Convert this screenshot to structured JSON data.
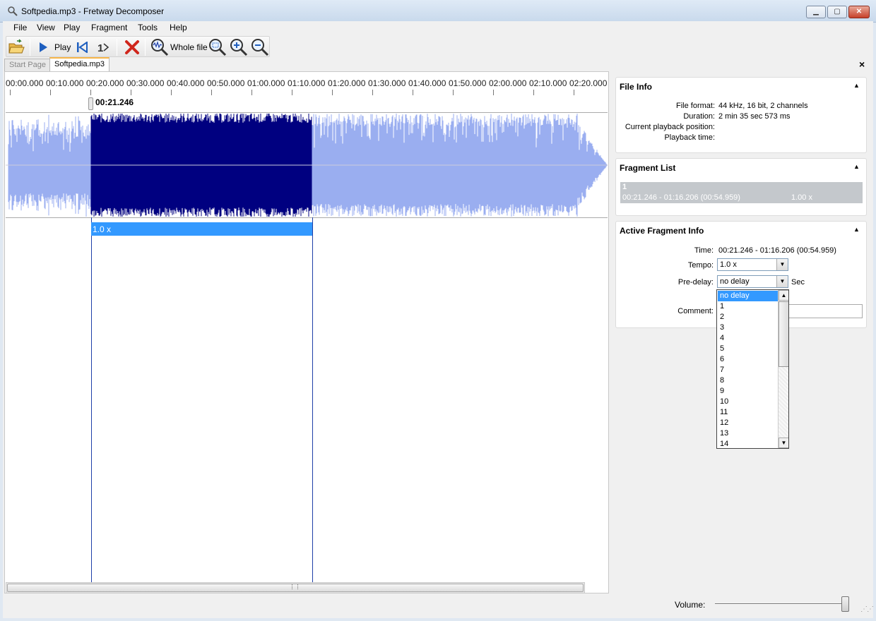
{
  "window": {
    "title": "Softpedia.mp3 - Fretway Decomposer",
    "buttons": {
      "minimize": "▁",
      "maximize": "▢",
      "close": "✕"
    }
  },
  "menu": [
    "File",
    "View",
    "Play",
    "Fragment",
    "Tools",
    "Help"
  ],
  "toolbar": {
    "play_label": "Play",
    "whole_file_label": "Whole file",
    "icons": [
      "open-folder-icon",
      "play-icon",
      "skip-to-start-icon",
      "repeat-one-icon",
      "delete-icon",
      "whole-file-zoom-icon",
      "zoom-fit-icon",
      "zoom-in-icon",
      "zoom-out-icon"
    ]
  },
  "tabs": [
    {
      "label": "Start Page",
      "active": false
    },
    {
      "label": "Softpedia.mp3",
      "active": true
    }
  ],
  "close_doc": "×",
  "timeline": {
    "ticks": [
      "00:00.000",
      "00:10.000",
      "00:20.000",
      "00:30.000",
      "00:40.000",
      "00:50.000",
      "01:00.000",
      "01:10.000",
      "01:20.000",
      "01:30.000",
      "01:40.000",
      "01:50.000",
      "02:00.000",
      "02:10.000",
      "02:20.000"
    ],
    "cursor_label": "00:21.246"
  },
  "waveform": {
    "selection_color": "#000080",
    "wave_color": "#9aaef0"
  },
  "fragment_bar_label": "1.0 x",
  "file_info": {
    "title": "File Info",
    "rows": [
      {
        "label": "File format:",
        "value": "44 kHz, 16 bit, 2 channels"
      },
      {
        "label": "Duration:",
        "value": "2 min 35 sec 573 ms"
      },
      {
        "label": "Current playback position:",
        "value": ""
      },
      {
        "label": "Playback time:",
        "value": ""
      }
    ]
  },
  "fragment_list": {
    "title": "Fragment List",
    "items": [
      {
        "number": "1",
        "range": "00:21.246 - 01:16.206 (00:54.959)",
        "tempo": "1.00 x"
      }
    ]
  },
  "active_fragment": {
    "title": "Active Fragment Info",
    "time_label": "Time:",
    "time_value": "00:21.246 - 01:16.206 (00:54.959)",
    "tempo_label": "Tempo:",
    "tempo_value": "1.0 x",
    "predelay_label": "Pre-delay:",
    "predelay_value": "no delay",
    "predelay_unit": "Sec",
    "comment_label": "Comment:",
    "comment_value": ""
  },
  "predelay_options": [
    "no delay",
    "1",
    "2",
    "3",
    "4",
    "5",
    "6",
    "7",
    "8",
    "9",
    "10",
    "11",
    "12",
    "13",
    "14"
  ],
  "status": {
    "volume_label": "Volume:",
    "volume_level": 1.0
  }
}
